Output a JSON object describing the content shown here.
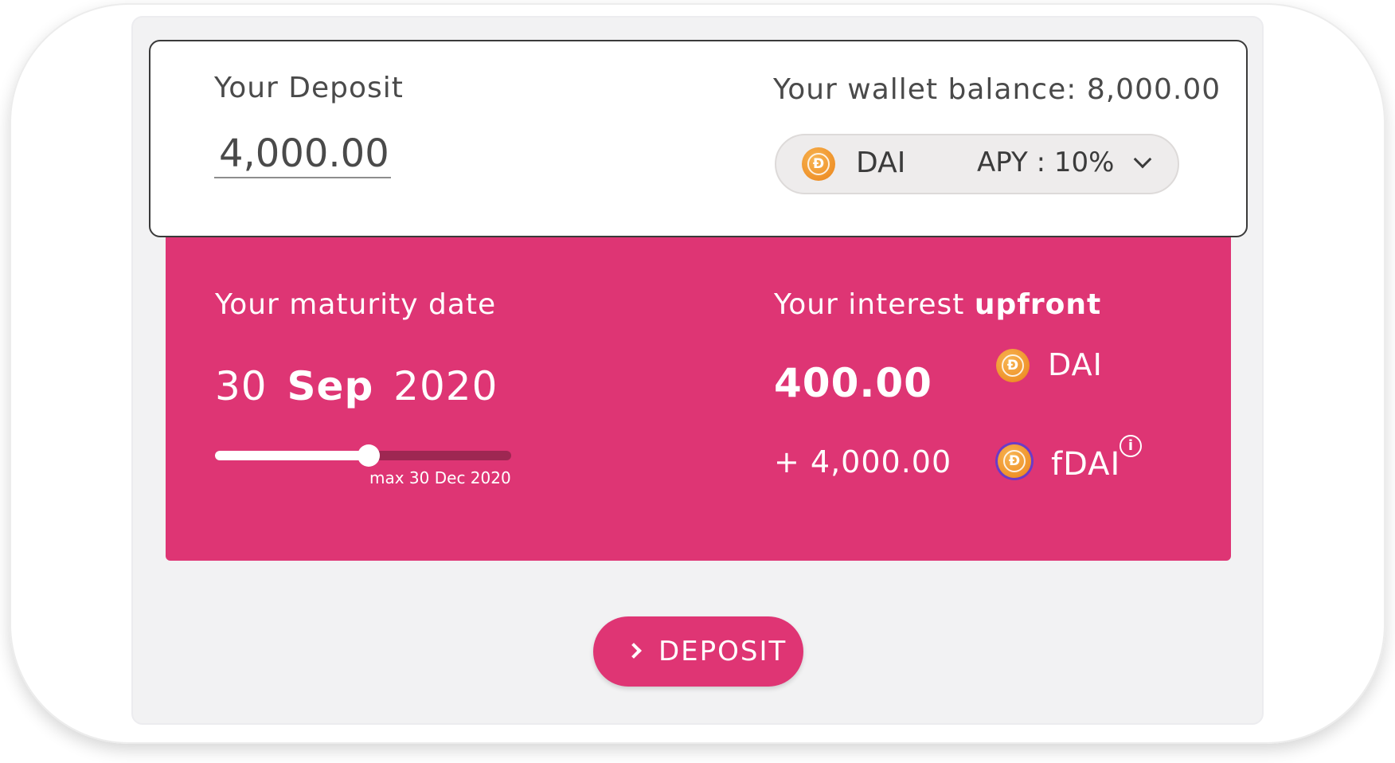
{
  "deposit": {
    "label": "Your Deposit",
    "amount": "4,000.00"
  },
  "wallet": {
    "label": "Your wallet balance: 8,000.00"
  },
  "token_select": {
    "token": "DAI",
    "coin_glyph": "Đ",
    "apy": "APY : 10%",
    "icon": "chevron-down-icon"
  },
  "maturity": {
    "label": "Your maturity date",
    "day": "30",
    "month": "Sep",
    "year": "2020",
    "slider_fraction": 0.52,
    "max_caption": "max 30 Dec 2020"
  },
  "interest": {
    "label_prefix": "Your interest",
    "label_bold": "upfront",
    "amount": "400.00",
    "token": "DAI",
    "principal": "+ 4,000.00",
    "ftoken": "fDAI",
    "info_glyph": "i"
  },
  "action": {
    "label": "DEPOSIT",
    "icon": "chevron-right-icon"
  },
  "colors": {
    "accent_pink": "#de3574",
    "dai_orange": "#ef922a",
    "fdai_ring": "#6a3cc8"
  }
}
